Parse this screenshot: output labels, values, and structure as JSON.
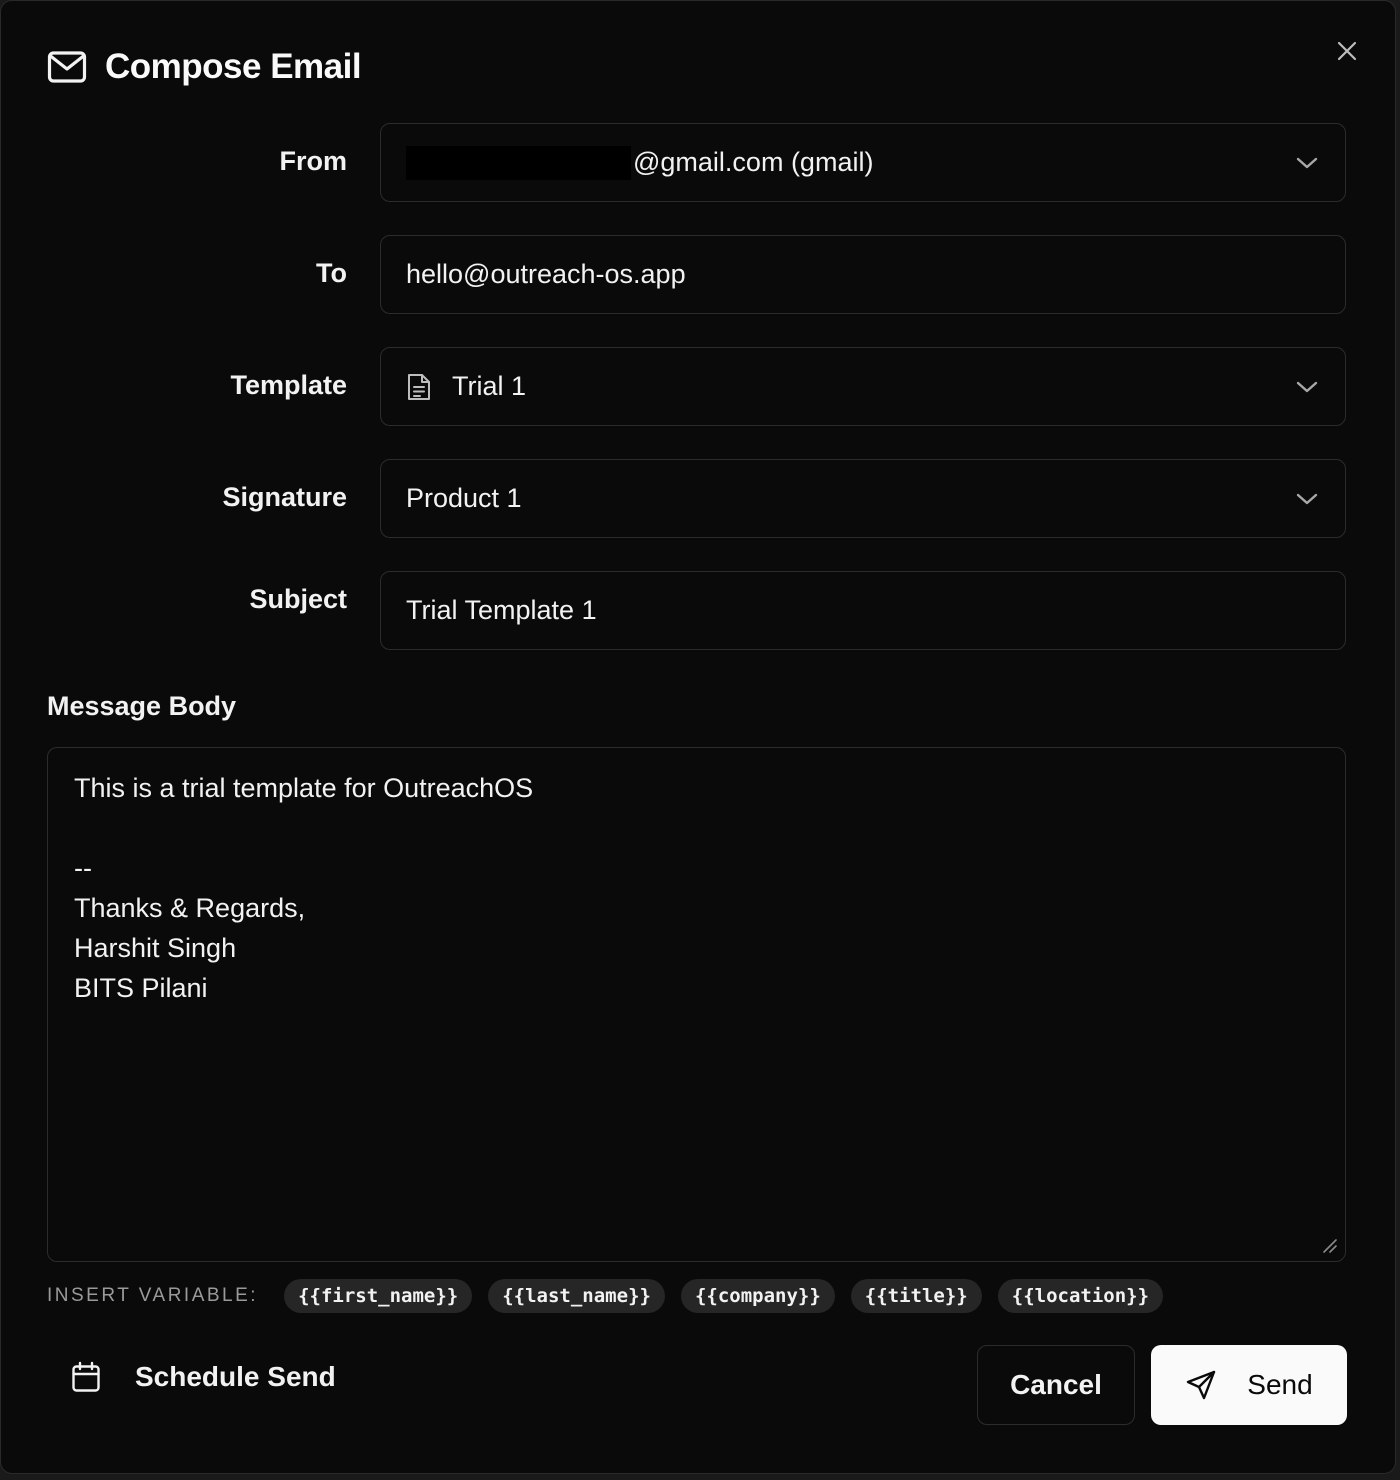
{
  "dialog": {
    "title": "Compose Email",
    "icons": {
      "title": "mail-icon",
      "close": "close-icon"
    }
  },
  "fields": {
    "from": {
      "label": "From",
      "value_suffix": "@gmail.com (gmail)"
    },
    "to": {
      "label": "To",
      "value": "hello@outreach-os.app"
    },
    "template": {
      "label": "Template",
      "value": "Trial 1",
      "icon": "document-icon"
    },
    "signature": {
      "label": "Signature",
      "value": "Product 1"
    },
    "subject": {
      "label": "Subject",
      "value": "Trial Template 1"
    }
  },
  "message": {
    "label": "Message Body",
    "lines": [
      "This is a trial template for OutreachOS",
      "",
      "--",
      "Thanks & Regards,",
      "Harshit Singh",
      "BITS Pilani"
    ]
  },
  "variables": {
    "label": "INSERT VARIABLE:",
    "chips": [
      "{{first_name}}",
      "{{last_name}}",
      "{{company}}",
      "{{title}}",
      "{{location}}"
    ]
  },
  "footer": {
    "schedule_label": "Schedule Send",
    "cancel_label": "Cancel",
    "send_label": "Send"
  }
}
